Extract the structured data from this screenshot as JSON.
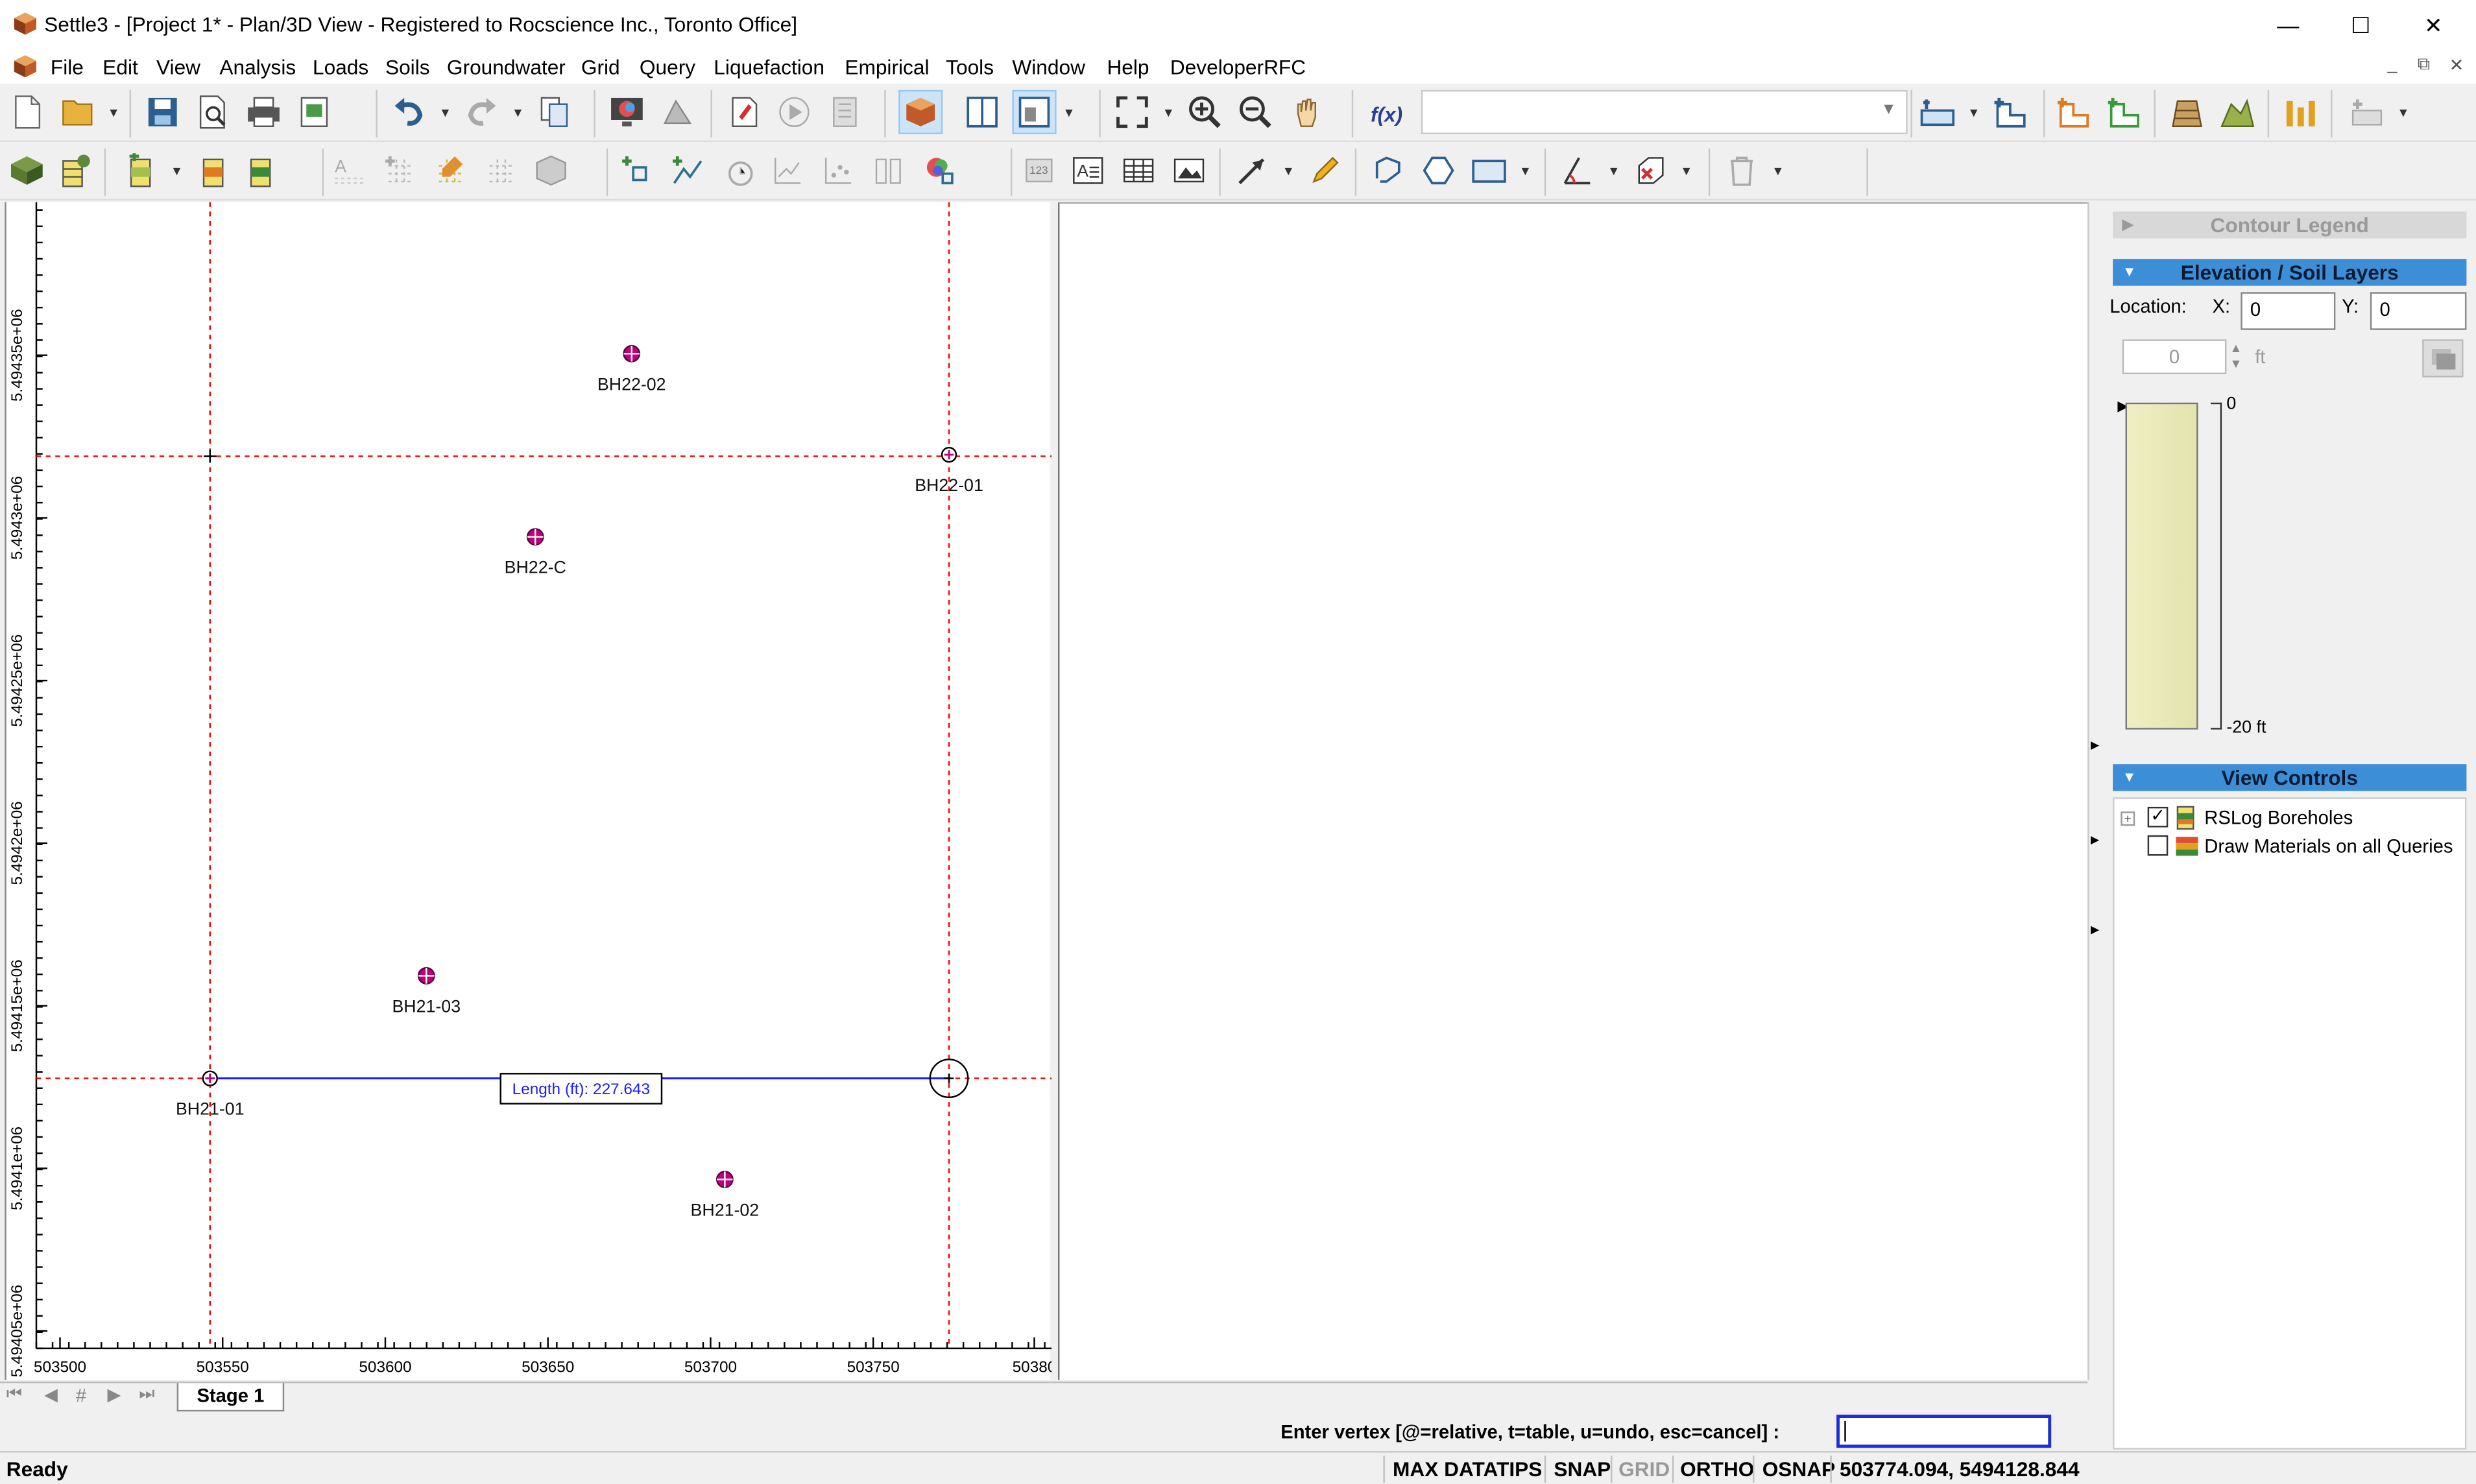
{
  "window": {
    "title": "Settle3 - [Project 1* - Plan/3D View - Registered to Rocscience Inc., Toronto Office]",
    "minimize": "—",
    "maximize": "☐",
    "close": "✕"
  },
  "menu": [
    "File",
    "Edit",
    "View",
    "Analysis",
    "Loads",
    "Soils",
    "Groundwater",
    "Grid",
    "Query",
    "Liquefaction",
    "Empirical",
    "Tools",
    "Window",
    "Help",
    "DeveloperRFC"
  ],
  "mdi": {
    "minimize": "_",
    "restore": "⧉",
    "close": "✕"
  },
  "plan": {
    "x_ticks": [
      "503500",
      "503550",
      "503600",
      "503650",
      "503700",
      "503750",
      "50380"
    ],
    "y_ticks": [
      "5.49435e+06",
      "5.4943e+06",
      "5.49425e+06",
      "5.4942e+06",
      "5.49415e+06",
      "5.4941e+06",
      "5.49405e+06"
    ],
    "boreholes": [
      {
        "name": "BH22-02"
      },
      {
        "name": "BH22-01"
      },
      {
        "name": "BH22-C"
      },
      {
        "name": "BH21-03"
      },
      {
        "name": "BH21-01"
      },
      {
        "name": "BH21-02"
      }
    ],
    "measure_label": "Length (ft): 227.643"
  },
  "panel": {
    "contour_legend": "Contour Legend",
    "elevation_title": "Elevation / Soil Layers",
    "location_label": "Location:",
    "x_label": "X:",
    "y_label": "Y:",
    "x_value": "0",
    "y_value": "0",
    "elev_value": "0",
    "elev_unit": "ft",
    "top_label": "0",
    "bottom_label": "-20 ft",
    "view_controls": "View Controls",
    "controls": [
      {
        "label": "RSLog Boreholes",
        "checked": true
      },
      {
        "label": "Draw Materials on all Queries",
        "checked": false
      }
    ]
  },
  "tabs": {
    "stage": "Stage 1"
  },
  "command": {
    "prompt": "Enter vertex [@=relative, t=table, u=undo, esc=cancel] :",
    "value": ""
  },
  "status": {
    "ready": "Ready",
    "max_datatips": "MAX DATATIPS",
    "snap": "SNAP",
    "grid": "GRID",
    "ortho": "ORTHO",
    "osnap": "OSNAP",
    "coords": "503774.094,  5494128.844"
  },
  "colors": {
    "accent": "#3c8fd6",
    "crosshair": "#ff0000",
    "measure_line": "#1a1aff",
    "borehole": "#c0007a"
  }
}
